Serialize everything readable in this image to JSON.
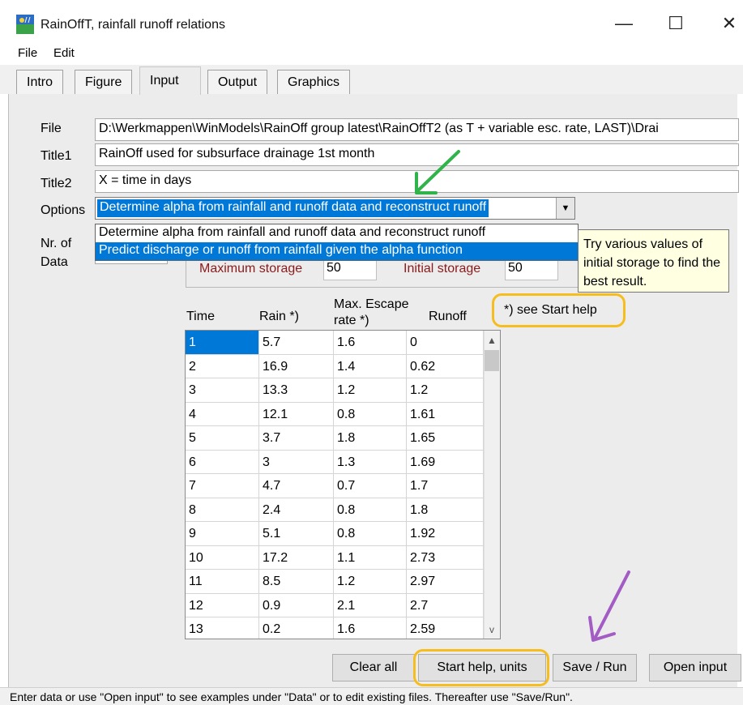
{
  "window": {
    "title": "RainOffT, rainfall runoff relations",
    "minimize": "—",
    "maximize": "☐",
    "close": "✕"
  },
  "menu": [
    "File",
    "Edit"
  ],
  "tabs": [
    {
      "label": "Intro",
      "active": false
    },
    {
      "label": "Figure",
      "active": false
    },
    {
      "label": "Input",
      "active": true
    },
    {
      "label": "Output",
      "active": false
    },
    {
      "label": "Graphics",
      "active": false
    }
  ],
  "form": {
    "file_label": "File",
    "file_value": "D:\\Werkmappen\\WinModels\\RainOff group latest\\RainOffT2 (as T + variable esc. rate, LAST)\\Drai",
    "title1_label": "Title1",
    "title1_value": "RainOff used for subsurface drainage 1st month",
    "title2_label": "Title2",
    "title2_value": "X = time in days",
    "options_label": "Options",
    "options_selected": "Determine alpha from rainfall and runoff data and reconstruct runoff",
    "options_list": [
      "Determine alpha from rainfall and runoff data and reconstruct runoff",
      "Predict discharge or runoff from rainfall given the alpha function"
    ],
    "nr_label_1": "Nr. of",
    "nr_label_2": "Data",
    "max_storage_label": "Maximum storage",
    "max_storage_value": "50",
    "initial_storage_label": "Initial storage",
    "initial_storage_value": "50",
    "tooltip": "Try various values of initial storage to find the best result."
  },
  "grid": {
    "headers": {
      "time": "Time",
      "rain": "Rain *)",
      "esc1": "Max. Escape",
      "esc2": "rate  *)",
      "runoff": "Runoff"
    },
    "start_help_note": "*) see Start help",
    "rows": [
      [
        "1",
        "5.7",
        "1.6",
        "0"
      ],
      [
        "2",
        "16.9",
        "1.4",
        "0.62"
      ],
      [
        "3",
        "13.3",
        "1.2",
        "1.2"
      ],
      [
        "4",
        "12.1",
        "0.8",
        "1.61"
      ],
      [
        "5",
        "3.7",
        "1.8",
        "1.65"
      ],
      [
        "6",
        "3",
        "1.3",
        "1.69"
      ],
      [
        "7",
        "4.7",
        "0.7",
        "1.7"
      ],
      [
        "8",
        "2.4",
        "0.8",
        "1.8"
      ],
      [
        "9",
        "5.1",
        "0.8",
        "1.92"
      ],
      [
        "10",
        "17.2",
        "1.1",
        "2.73"
      ],
      [
        "11",
        "8.5",
        "1.2",
        "2.97"
      ],
      [
        "12",
        "0.9",
        "2.1",
        "2.7"
      ],
      [
        "13",
        "0.2",
        "1.6",
        "2.59"
      ]
    ]
  },
  "buttons": {
    "clear_all": "Clear all",
    "start_help": "Start help, units",
    "save_run": "Save / Run",
    "open_input": "Open input"
  },
  "status": "Enter data or use \"Open input\" to see examples under \"Data\" or to edit existing files. Thereafter use \"Save/Run\".",
  "colors": {
    "selection": "#0078d7",
    "highlight_box": "#f6bd1f",
    "green_arrow": "#2fb34a",
    "purple_arrow": "#a35cc4",
    "storage_label": "#8b1a1a",
    "tooltip_bg": "#ffffe1"
  }
}
